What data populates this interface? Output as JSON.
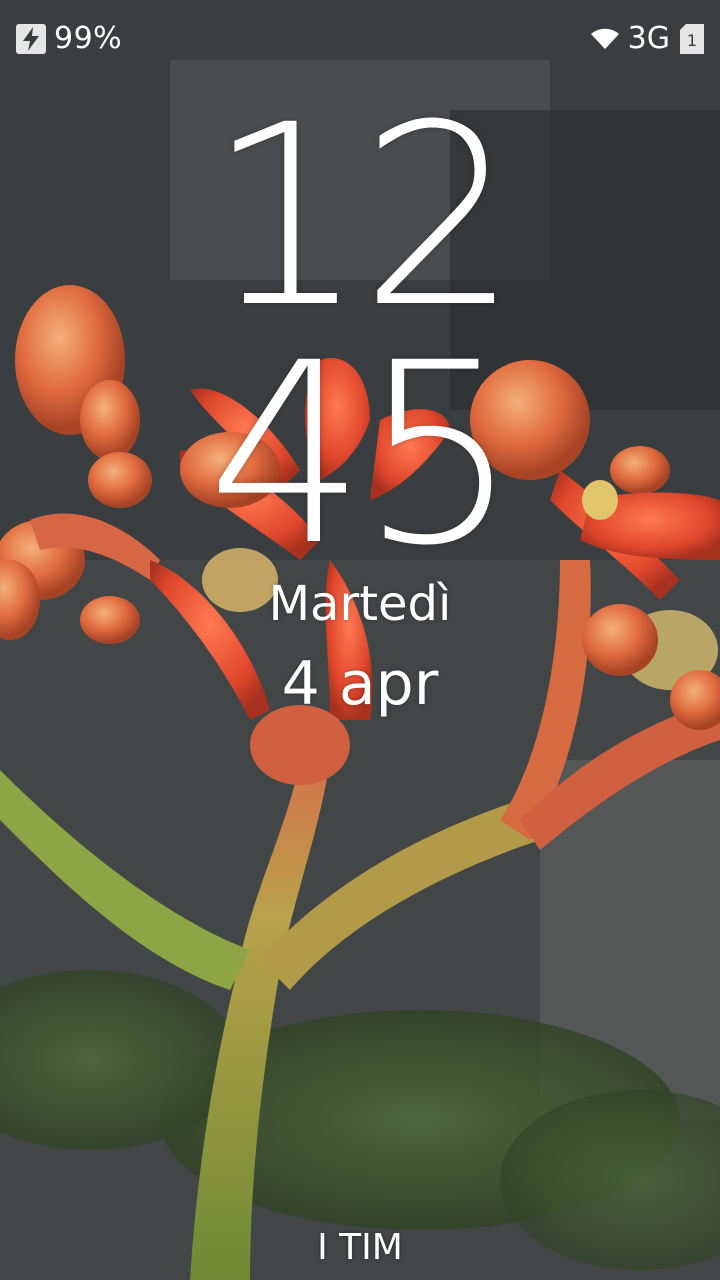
{
  "status_bar": {
    "battery_percent": "99%",
    "battery_icon": "charging-bolt-icon",
    "network_type": "3G",
    "wifi_icon": "wifi-icon",
    "sim_icon": "sim-card-icon",
    "sim_slot": "1"
  },
  "lockscreen": {
    "hours": "12",
    "minutes": "45",
    "day": "Martedì",
    "date": "4 apr",
    "carrier": "I TIM"
  },
  "colors": {
    "accent": "#2a8c85",
    "text": "#ffffff",
    "flower": "#e8543a",
    "stem": "#9bb04a"
  }
}
